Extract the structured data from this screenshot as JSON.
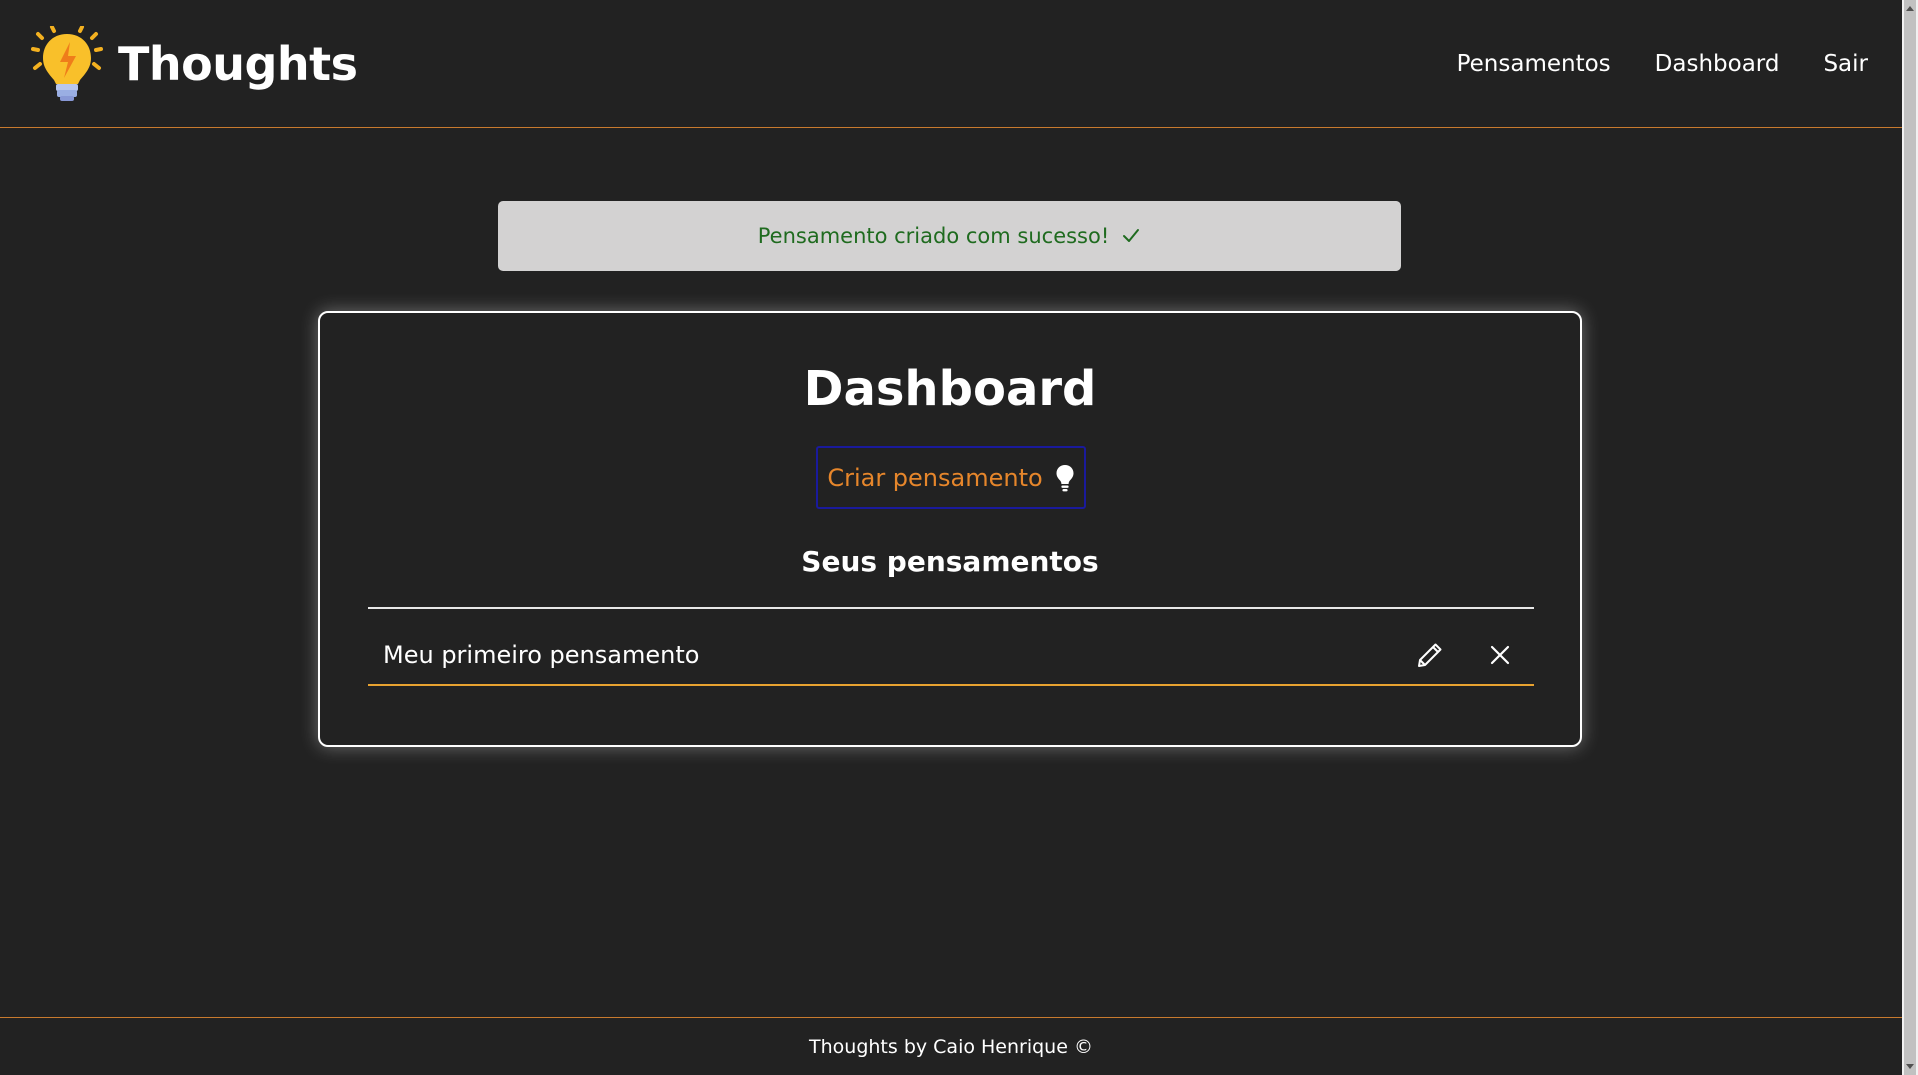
{
  "navbar": {
    "brand": "Thoughts",
    "links": [
      "Pensamentos",
      "Dashboard",
      "Sair"
    ]
  },
  "flash": {
    "message": "Pensamento criado com sucesso!"
  },
  "dashboard": {
    "title": "Dashboard",
    "create_button": "Criar pensamento",
    "section_title": "Seus pensamentos",
    "thoughts": [
      {
        "title": "Meu primeiro pensamento"
      }
    ]
  },
  "footer": {
    "text": "Thoughts by Caio Henrique ©"
  },
  "colors": {
    "background": "#222222",
    "accent_orange": "#e6862b",
    "border_orange": "#c97a2e",
    "flash_bg": "#d3d2d2",
    "flash_text": "#1f6b1f",
    "button_border": "#1a1a9c"
  },
  "icons": {
    "brand": "lightbulb-logo-icon",
    "flash": "check-icon",
    "create": "lightbulb-icon",
    "edit": "pencil-icon",
    "delete": "close-icon"
  }
}
